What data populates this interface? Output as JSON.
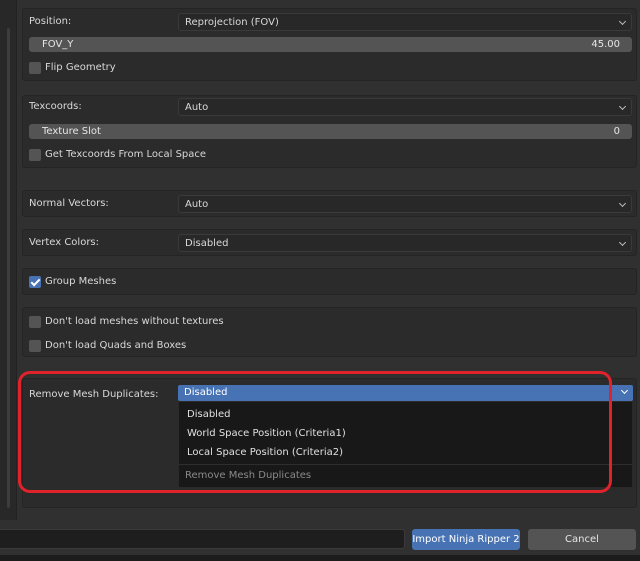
{
  "panels": {
    "position": {
      "label": "Position:",
      "value": "Reprojection (FOV)",
      "fov_name": "FOV_Y",
      "fov_value": "45.00",
      "flip_label": "Flip Geometry",
      "flip_checked": false
    },
    "texcoords": {
      "label": "Texcoords:",
      "value": "Auto",
      "slot_name": "Texture Slot",
      "slot_value": "0",
      "local_label": "Get Texcoords From Local Space",
      "local_checked": false
    },
    "normals": {
      "label": "Normal Vectors:",
      "value": "Auto"
    },
    "vertex_colors": {
      "label": "Vertex Colors:",
      "value": "Disabled"
    },
    "group_meshes": {
      "label": "Group Meshes",
      "checked": true
    },
    "load": {
      "no_textures_label": "Don't load meshes without textures",
      "no_quads_label": "Don't load Quads and Boxes"
    },
    "duplicates": {
      "label": "Remove Mesh Duplicates:",
      "value": "Disabled",
      "options": [
        "Disabled",
        "World Space Position (Criteria1)",
        "Local Space Position (Criteria2)"
      ],
      "footer": "Remove Mesh Duplicates"
    }
  },
  "buttons": {
    "import": "Import Ninja Ripper 2",
    "cancel": "Cancel"
  },
  "colors": {
    "accent": "#4772b3",
    "highlight": "#e0222b",
    "background": "#303030"
  }
}
